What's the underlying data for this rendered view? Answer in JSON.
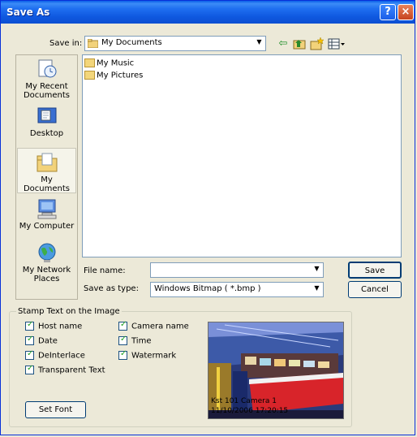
{
  "dialog": {
    "title": "Save As",
    "help_glyph": "?",
    "close_glyph": "×"
  },
  "save_in": {
    "label": "Save in:",
    "value": "My Documents",
    "icon": "folder-icon"
  },
  "toolbar": {
    "back_icon": "back-arrow-icon",
    "up_folder_icon": "up-one-level-icon",
    "new_folder_icon": "new-folder-icon",
    "views_icon": "views-menu-icon"
  },
  "places": [
    {
      "id": "recent",
      "label": "My Recent Documents",
      "icon": "recent-documents-icon"
    },
    {
      "id": "desktop",
      "label": "Desktop",
      "icon": "desktop-icon"
    },
    {
      "id": "documents",
      "label": "My Documents",
      "icon": "my-documents-icon",
      "selected": true
    },
    {
      "id": "computer",
      "label": "My Computer",
      "icon": "my-computer-icon"
    },
    {
      "id": "network",
      "label": "My Network Places",
      "icon": "network-places-icon"
    }
  ],
  "files": [
    {
      "name": "My Music",
      "icon": "folder-icon"
    },
    {
      "name": "My Pictures",
      "icon": "folder-icon"
    }
  ],
  "file_name": {
    "label": "File name:",
    "value": ""
  },
  "save_type": {
    "label": "Save as type:",
    "value": "Windows Bitmap ( *.bmp )"
  },
  "buttons": {
    "save": "Save",
    "cancel": "Cancel",
    "set_font": "Set Font"
  },
  "stamp": {
    "legend": "Stamp Text on the Image",
    "options": [
      {
        "label": "Host name",
        "checked": true
      },
      {
        "label": "Date",
        "checked": true
      },
      {
        "label": "DeInterlace",
        "checked": true
      },
      {
        "label": "Transparent Text",
        "checked": true
      },
      {
        "label": "Camera name",
        "checked": true
      },
      {
        "label": "Time",
        "checked": true
      },
      {
        "label": "Watermark",
        "checked": true
      }
    ]
  },
  "preview": {
    "line1": "Kst 101 Camera 1",
    "line2": "11/10/2006 17:20:15"
  },
  "colors": {
    "title_bar": "#0a5ee8",
    "face": "#ece9d8",
    "border": "#7f9db9"
  }
}
